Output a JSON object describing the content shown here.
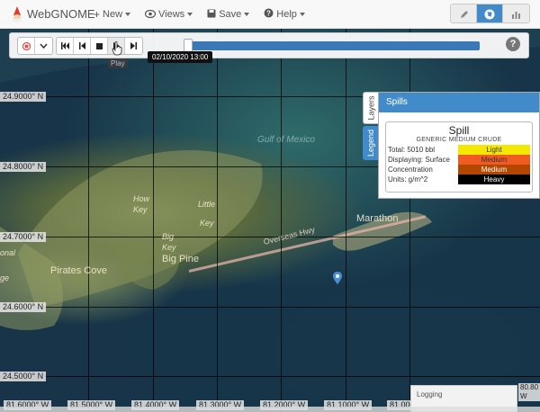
{
  "app": {
    "brand": "WebGNOME"
  },
  "nav": {
    "new_label": "New",
    "views_label": "Views",
    "save_label": "Save",
    "help_label": "Help"
  },
  "view_switch": {
    "items": [
      "setup-view",
      "map-view",
      "fate-view"
    ],
    "active": "map-view"
  },
  "toolbar": {
    "tooltip_time": "02/10/2020 13:00",
    "play_tooltip": "Play",
    "progress_percent": 100
  },
  "map": {
    "lat_labels": [
      "24.9000° N",
      "24.8000° N",
      "24.7000° N",
      "24.6000° N",
      "24.5000° N"
    ],
    "lon_labels": [
      "81.6000° W",
      "81.5000° W",
      "81.4000° W",
      "81.3000° W",
      "81.2000° W",
      "81.1000° W",
      "81.0000° W"
    ],
    "corner_coord": [
      "80.80",
      "W"
    ],
    "features": {
      "gulf": "Gulf of Mexico",
      "marathon": "Marathon",
      "highway": "Overseas Hwy",
      "pirates_cove": "Pirates Cove",
      "big_pine": "Big Pine",
      "how": "How",
      "little": "Little",
      "key1": "Key",
      "key2": "Key",
      "big": "Big",
      "key3": "Key",
      "onal": "onal",
      "ge": "ge"
    }
  },
  "side_tabs": {
    "layers": "Layers",
    "legend": "Legend"
  },
  "spills_panel": {
    "title": "Spills",
    "legend_title": "Spill",
    "oil_name": "GENERIC MEDIUM CRUDE",
    "rows": [
      {
        "label": "Total: 5010 bbl",
        "value": "Light",
        "color": "#f5e800",
        "text_color": "#333333"
      },
      {
        "label": "Displaying: Surface",
        "value": "Medium",
        "color": "#f15a22",
        "text_color": "#333333"
      },
      {
        "label": "Concentration",
        "value": "Medium",
        "color": "#b34700",
        "text_color": "#ffffff"
      },
      {
        "label": "Units: g/m^2",
        "value": "Heavy",
        "color": "#000000",
        "text_color": "#ffffff"
      }
    ]
  },
  "logging": {
    "label": "Logging"
  },
  "colors": {
    "accent": "#428bca",
    "progress": "#3a78b6",
    "marker": "#4a90d9"
  }
}
